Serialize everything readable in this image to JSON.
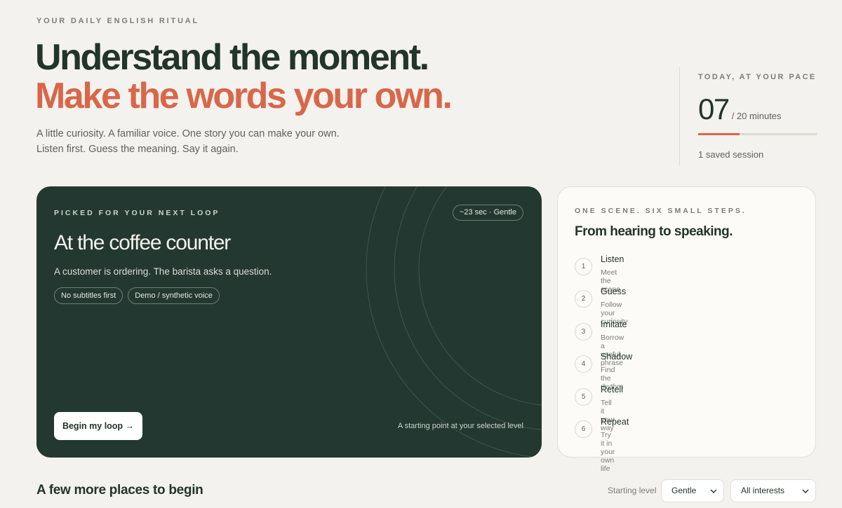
{
  "hero": {
    "eyebrow": "YOUR DAILY ENGLISH RITUAL",
    "headline_line1": "Understand the moment.",
    "headline_line2": "Make the words your own.",
    "intro_line1": "A little curiosity. A familiar voice. One story you can make your own.",
    "intro_line2": "Listen first. Guess the meaning. Say it again."
  },
  "today": {
    "label": "TODAY, AT YOUR PACE",
    "minutes_done": "07",
    "minutes_total_text": "/ 20 minutes",
    "progress_fraction": 0.35,
    "saved_text": "1 saved session",
    "accent_color": "#d8674a"
  },
  "feature": {
    "kicker": "PICKED FOR YOUR NEXT LOOP",
    "duration_badge": "~23 sec · Gentle",
    "title": "At the coffee counter",
    "description": "A customer is ordering. The barista asks a question.",
    "chips": [
      "No subtitles first",
      "Demo / synthetic voice"
    ],
    "begin_label": "Begin my loop →",
    "level_note": "A starting point at your selected level",
    "bg_color": "#233830"
  },
  "steps": {
    "kicker": "ONE SCENE. SIX SMALL STEPS.",
    "title": "From hearing to speaking.",
    "items": [
      {
        "num": "1",
        "name": "Listen",
        "sub": "Meet the scene"
      },
      {
        "num": "2",
        "name": "Guess",
        "sub": "Follow your curiosity"
      },
      {
        "num": "3",
        "name": "Imitate",
        "sub": "Borrow a useful phrase"
      },
      {
        "num": "4",
        "name": "Shadow",
        "sub": "Find the rhythm"
      },
      {
        "num": "5",
        "name": "Retell",
        "sub": "Tell it your way"
      },
      {
        "num": "6",
        "name": "Repeat",
        "sub": "Try it in your own life"
      }
    ]
  },
  "more": {
    "title": "A few more places to begin",
    "level_label": "Starting level",
    "level_value": "Gentle",
    "interest_value": "All interests"
  },
  "icons": {
    "dropdown": "chevron-down-icon"
  }
}
